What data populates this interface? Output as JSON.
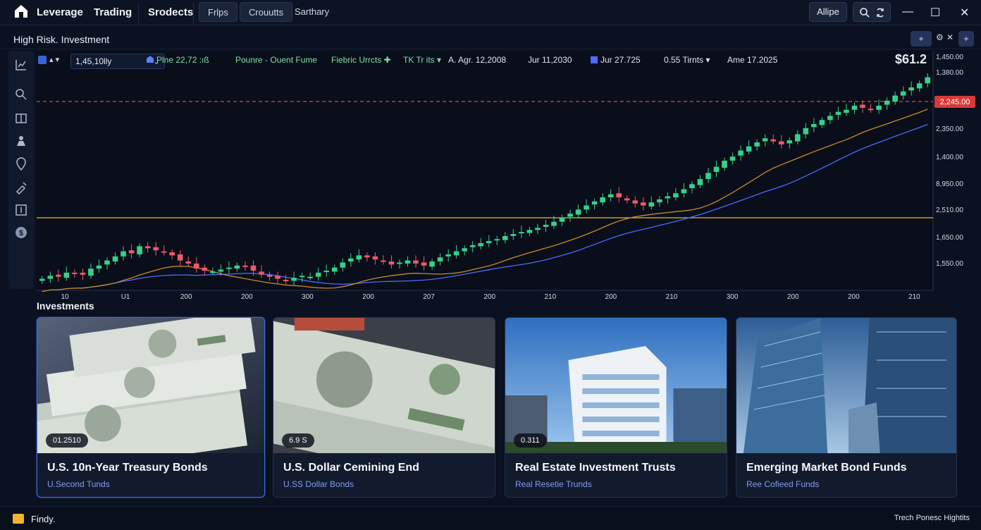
{
  "topnav": {
    "brand_label": "Leverage",
    "items": [
      "Trading",
      "Srodects"
    ],
    "pills": [
      {
        "label": "Frlps",
        "active": true
      },
      {
        "label": "Crouutts",
        "active": true
      },
      {
        "label": "Sarthary",
        "active": false
      }
    ],
    "user_label": "Allipe",
    "icons": [
      "home-icon",
      "search-icon",
      "settings-icon"
    ]
  },
  "window_controls": {
    "minimize": "—",
    "maximize": "☐",
    "close": "✕"
  },
  "subheader": {
    "title": "High Risk. Investment",
    "buttons": [
      "+",
      "⚙",
      "✕",
      "+"
    ]
  },
  "sidebar": {
    "icons": [
      "chart-icon",
      "search-icon",
      "book-icon",
      "person-icon",
      "location-icon",
      "sign-icon",
      "panel-icon",
      "dollar-icon"
    ]
  },
  "chart_toolbar": {
    "symbol": "1,45,10lly",
    "items": [
      {
        "label": "Plne 22,72 :ıß",
        "color": "green"
      },
      {
        "label": "Pounre - Ouent Fume",
        "color": "green"
      },
      {
        "label": "Fiebric Urrcts ✚",
        "color": "green"
      },
      {
        "label": "TK Tr its ▾",
        "color": "green"
      },
      {
        "label": "A. Agr. 12,2008",
        "color": "white"
      },
      {
        "label": "Jur 11,2030",
        "color": "white"
      },
      {
        "label": "Jur 27.725",
        "color": "white"
      },
      {
        "label": "0.55 Tirnts ▾",
        "color": "white"
      },
      {
        "label": "Ame 17.2025",
        "color": "white"
      }
    ],
    "price_readout": "$61.2"
  },
  "chart_data": {
    "type": "candlestick",
    "title": "",
    "xlabel": "",
    "ylabel": "",
    "x_ticks": [
      "10",
      "U1",
      "200",
      "200",
      "300",
      "200",
      "207",
      "200",
      "210",
      "200",
      "210",
      "300",
      "200",
      "200",
      "210"
    ],
    "y_ticks": [
      "1,450.00",
      "1,380.00",
      "2,350.00",
      "1,400.00",
      "8,950.00",
      "2,510.00",
      "1,650.00",
      "1,550.00"
    ],
    "price_label": "2,245.00",
    "support_line_label": "",
    "reference_lines": [
      {
        "name": "red-dashed",
        "color": "#e04848"
      },
      {
        "name": "yellow",
        "color": "#f3b72e"
      }
    ],
    "ma_colors": [
      "#4c6bff",
      "#c98a2a"
    ],
    "up_color": "#36d18a",
    "down_color": "#ee5a69",
    "close_series": [
      20,
      23,
      22,
      26,
      25,
      24,
      30,
      33,
      38,
      42,
      47,
      45,
      52,
      50,
      48,
      46,
      43,
      38,
      35,
      30,
      28,
      27,
      29,
      31,
      33,
      32,
      28,
      24,
      22,
      20,
      18,
      21,
      23,
      22,
      26,
      28,
      31,
      36,
      40,
      43,
      41,
      39,
      37,
      34,
      36,
      38,
      35,
      33,
      37,
      41,
      44,
      47,
      50,
      53,
      55,
      57,
      59,
      62,
      64,
      66,
      68,
      70,
      73,
      76,
      80,
      84,
      88,
      92,
      96,
      100,
      103,
      100,
      97,
      94,
      92,
      95,
      98,
      101,
      104,
      108,
      113,
      118,
      124,
      130,
      136,
      140,
      146,
      150,
      154,
      158,
      155,
      152,
      156,
      162,
      168,
      172,
      176,
      180,
      184,
      186,
      190,
      188,
      186,
      190,
      195,
      200,
      204,
      208,
      212,
      218
    ]
  },
  "investments": {
    "section_title": "Investments",
    "cards": [
      {
        "badge": "01.2510",
        "title": "U.S. 10n-Year Treasury Bonds",
        "subtitle": "U.Second Tunds",
        "image": "cash-stack",
        "selected": true
      },
      {
        "badge": "6.9 S",
        "title": "U.S. Dollar Cemining End",
        "subtitle": "U.SS Dollar Bonds",
        "image": "dollar-bills",
        "selected": false
      },
      {
        "badge": "0.311",
        "title": "Real Estate Investment Trusts",
        "subtitle": "Real Resetie Trunds",
        "image": "office-building",
        "selected": false
      },
      {
        "badge": "",
        "title": "Emerging Market Bond Funds",
        "subtitle": "Ree Cofieed Funds",
        "image": "skyscrapers",
        "selected": false
      }
    ]
  },
  "footer": {
    "label": "Findy.",
    "right_text": "Trech Ponesc Hightits"
  }
}
